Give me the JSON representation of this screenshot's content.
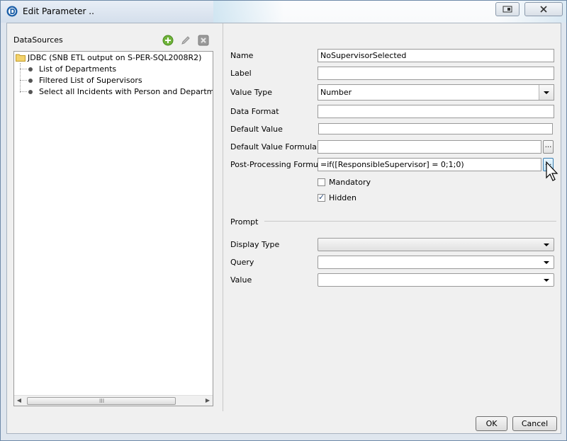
{
  "window": {
    "title": "Edit Parameter .."
  },
  "left": {
    "datasources_label": "DataSources",
    "tree": {
      "root": "JDBC (SNB ETL output on S-PER-SQL2008R2)",
      "children": [
        "List of Departments",
        "Filtered List of Supervisors",
        "Select all Incidents with Person and Department res"
      ]
    }
  },
  "form": {
    "name_label": "Name",
    "name_value": "NoSupervisorSelected",
    "label_label": "Label",
    "label_value": "",
    "value_type_label": "Value Type",
    "value_type_value": "Number",
    "data_format_label": "Data Format",
    "data_format_value": "",
    "default_value_label": "Default Value",
    "default_value_value": "",
    "default_value_formula_label": "Default Value Formula",
    "default_value_formula_value": "",
    "post_processing_label": "Post-Processing Formula",
    "post_processing_value": "=if([ResponsibleSupervisor] = 0;1;0)",
    "ellipsis": "...",
    "mandatory_label": "Mandatory",
    "mandatory_checked": false,
    "hidden_label": "Hidden",
    "hidden_checked": true
  },
  "prompt": {
    "section_label": "Prompt",
    "display_type_label": "Display Type",
    "query_label": "Query",
    "value_label": "Value"
  },
  "buttons": {
    "ok": "OK",
    "cancel": "Cancel"
  },
  "scrollbar_grip": "III"
}
